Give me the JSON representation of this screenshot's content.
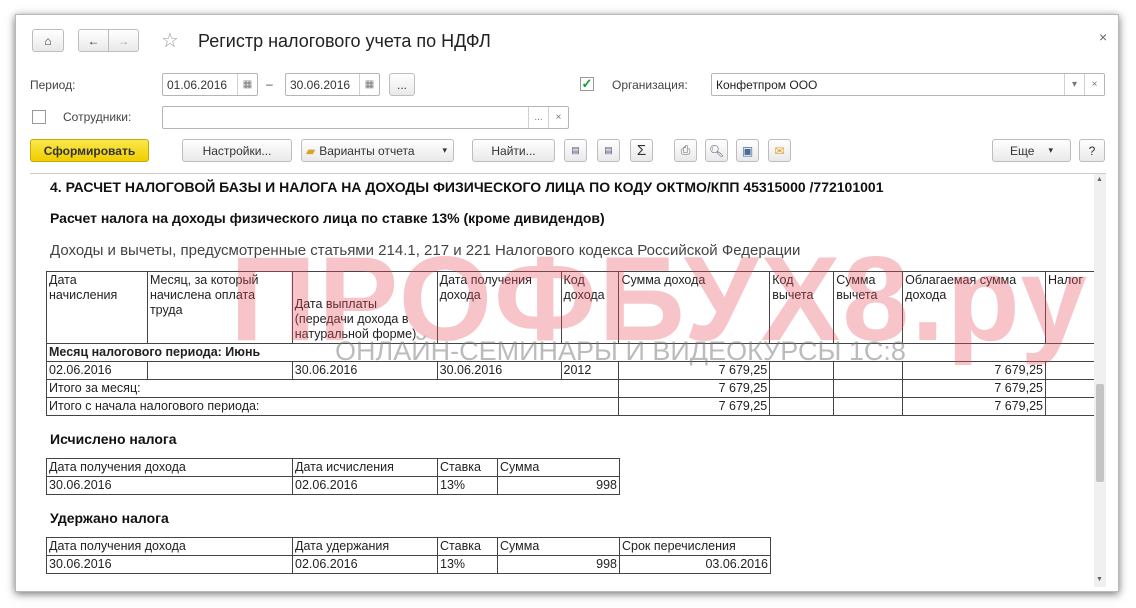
{
  "window": {
    "title": "Регистр налогового учета по НДФЛ",
    "close": "×"
  },
  "form": {
    "period_label": "Период:",
    "date_from": "01.06.2016",
    "dash": "–",
    "date_to": "30.06.2016",
    "period_more": "...",
    "org_checked": true,
    "org_label": "Организация:",
    "org_value": "Конфетпром ООО",
    "emp_checked": false,
    "emp_label": "Сотрудники:",
    "emp_value": "",
    "more": "...",
    "clear": "×",
    "dropdown": "▾"
  },
  "toolbar": {
    "generate": "Сформировать",
    "settings": "Настройки...",
    "variants": "Варианты отчета",
    "find": "Найти...",
    "more": "Еще",
    "help": "?",
    "sum": "Σ"
  },
  "report": {
    "section_title": "4. РАСЧЕТ НАЛОГОВОЙ БАЗЫ И НАЛОГА НА ДОХОДЫ ФИЗИЧЕСКОГО ЛИЦА ПО КОДУ ОКТМО/КПП 45315000   /772101001",
    "subtitle": "Расчет налога на доходы физического лица по ставке 13% (кроме дивидендов)",
    "caption": "Доходы и вычеты, предусмотренные статьями 214.1, 217 и 221 Налогового кодекса Российской Федерации",
    "main_table": {
      "headers": [
        "Дата начисления",
        "Месяц, за который начислена оплата труда",
        "Дата выплаты (передачи дохода в натуральной форме)",
        "Дата получения дохода",
        "Код дохода",
        "Сумма дохода",
        "Код вычета",
        "Сумма вычета",
        "Облагаемая сумма дохода",
        "Налог"
      ],
      "group": "Месяц налогового периода: Июнь",
      "row": [
        "02.06.2016",
        "",
        "30.06.2016",
        "30.06.2016",
        "2012",
        "7 679,25",
        "",
        "",
        "7 679,25",
        ""
      ],
      "total_month": {
        "label": "Итого за месяц:",
        "income": "7 679,25",
        "taxable": "7 679,25"
      },
      "total_period": {
        "label": "Итого с начала налогового периода:",
        "income": "7 679,25",
        "taxable": "7 679,25"
      }
    },
    "calc": {
      "title": "Исчислено налога",
      "headers": [
        "Дата получения дохода",
        "Дата исчисления",
        "Ставка",
        "Сумма"
      ],
      "row": [
        "30.06.2016",
        "02.06.2016",
        "13%",
        "998"
      ]
    },
    "withheld": {
      "title": "Удержано налога",
      "headers": [
        "Дата получения дохода",
        "Дата удержания",
        "Ставка",
        "Сумма",
        "Срок перечисления"
      ],
      "row": [
        "30.06.2016",
        "02.06.2016",
        "13%",
        "998",
        "03.06.2016"
      ]
    }
  },
  "watermark": {
    "logo": "ПРОФБУХ8.ру",
    "tagline": "ОНЛАЙН-СЕМИНАРЫ И ВИДЕОКУРСЫ 1С:8"
  },
  "colors": {
    "generate_bg": "#f5d800",
    "check": "#1a9a2a"
  }
}
